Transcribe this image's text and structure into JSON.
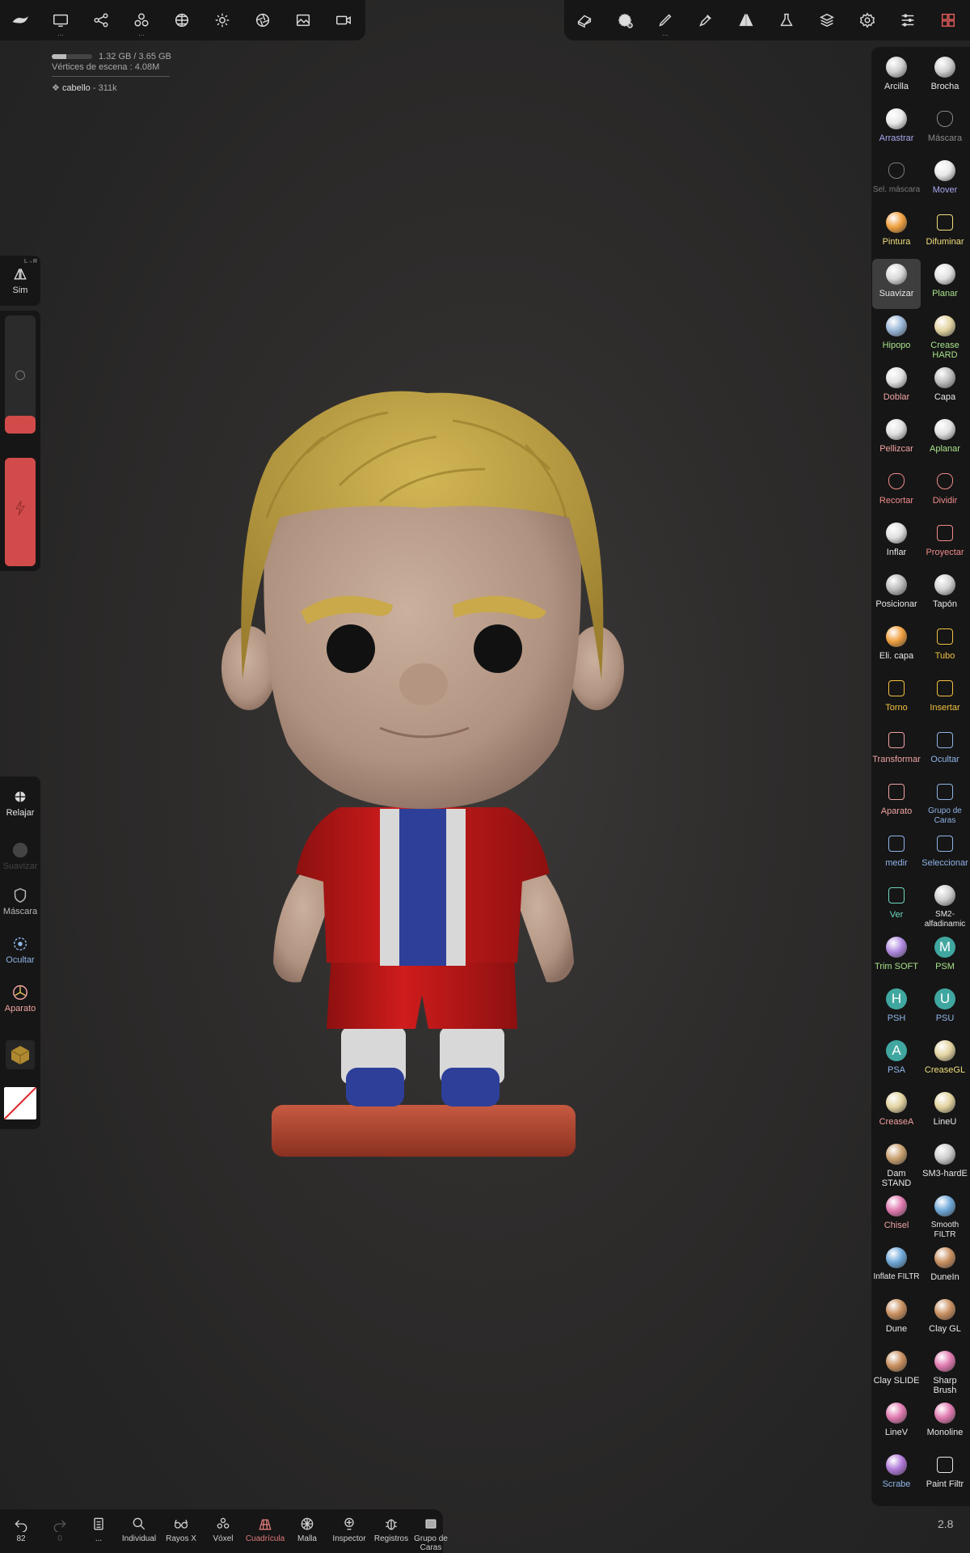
{
  "top_left_toolbar": {
    "items": [
      {
        "icon": "menu-swoosh-icon",
        "dots": ""
      },
      {
        "icon": "monitor-icon",
        "dots": "..."
      },
      {
        "icon": "share-nodes-icon",
        "dots": ""
      },
      {
        "icon": "spheres-icon",
        "dots": "..."
      },
      {
        "icon": "globe-grid-icon",
        "dots": ""
      },
      {
        "icon": "sun-icon",
        "dots": ""
      },
      {
        "icon": "aperture-icon",
        "dots": ""
      },
      {
        "icon": "image-icon",
        "dots": ""
      },
      {
        "icon": "video-camera-icon",
        "dots": ""
      }
    ]
  },
  "top_right_toolbar": {
    "items": [
      {
        "icon": "eraser-cube-icon",
        "dots": ""
      },
      {
        "icon": "stroke-stamp-icon",
        "dots": ""
      },
      {
        "icon": "brush-pen-icon",
        "dots": "..."
      },
      {
        "icon": "dropper-icon",
        "dots": ""
      },
      {
        "icon": "symmetry-icon",
        "dots": ""
      },
      {
        "icon": "flask-icon",
        "dots": ""
      },
      {
        "icon": "layers-icon",
        "dots": ""
      },
      {
        "icon": "settings-gear-icon",
        "dots": ""
      },
      {
        "icon": "sliders-icon",
        "dots": ""
      },
      {
        "icon": "tools-grid-icon",
        "dots": ""
      }
    ]
  },
  "scene_info": {
    "memory": "1.32 GB / 3.65 GB",
    "memory_fraction": 0.36,
    "vertices": "Vértices de escena : 4.08M",
    "object": "cabello",
    "object_count": "311k"
  },
  "left_panel": {
    "sim_label": "Sim",
    "sim_badge": "L→R",
    "tools": [
      {
        "label": "Relajar",
        "icon": "relax-icon",
        "color": "#e8e8e8"
      },
      {
        "label": "Suavizar",
        "icon": "smooth-ball-icon",
        "color": "#4a4a4a"
      },
      {
        "label": "Máscara",
        "icon": "mask-shield-icon",
        "color": "#b8b8b8"
      },
      {
        "label": "Ocultar",
        "icon": "hide-icon",
        "color": "#8fb4e8"
      },
      {
        "label": "Aparato",
        "icon": "gizmo-icon",
        "color": "#f0a3a3"
      }
    ]
  },
  "right_panel": {
    "brushes": [
      {
        "label": "Arcilla",
        "color": "#e8e8e8",
        "ic": "ball",
        "bg": "#cfcfcf"
      },
      {
        "label": "Brocha",
        "color": "#e8e8e8",
        "ic": "ball",
        "bg": "#cfcfcf"
      },
      {
        "label": "Arrastrar",
        "color": "#a9a8f0",
        "ic": "ball",
        "bg": "#e8e8e8"
      },
      {
        "label": "Máscara",
        "color": "#8a8a8a",
        "ic": "shield",
        "bg": "transparent"
      },
      {
        "label": "Sel. máscara",
        "color": "#7a7a7a",
        "ic": "shield",
        "bg": "transparent"
      },
      {
        "label": "Mover",
        "color": "#a9a8f0",
        "ic": "ball",
        "bg": "#e8e8e8"
      },
      {
        "label": "Pintura",
        "color": "#f2de7e",
        "ic": "ball",
        "bg": "#f0a040"
      },
      {
        "label": "Difuminar",
        "color": "#f2de7e",
        "ic": "smudge",
        "bg": "transparent"
      },
      {
        "label": "Suavizar",
        "color": "#e8e8e8",
        "ic": "ball",
        "bg": "#d9d9d9",
        "selected": true
      },
      {
        "label": "Planar",
        "color": "#a7e28a",
        "ic": "ball",
        "bg": "#e0e0e0"
      },
      {
        "label": "Hipopo",
        "color": "#a7e28a",
        "ic": "ball",
        "bg": "#9ab7d8"
      },
      {
        "label": "Crease HARD",
        "color": "#a7e28a",
        "ic": "ball",
        "bg": "#e2d3a0"
      },
      {
        "label": "Doblar",
        "color": "#f0a3a3",
        "ic": "ball",
        "bg": "#e0e0e0"
      },
      {
        "label": "Capa",
        "color": "#e8e8e8",
        "ic": "ball",
        "bg": "#bdbdbd"
      },
      {
        "label": "Pellizcar",
        "color": "#f0a3a3",
        "ic": "ball",
        "bg": "#e0e0e0"
      },
      {
        "label": "Aplanar",
        "color": "#a7e28a",
        "ic": "ball",
        "bg": "#e0e0e0"
      },
      {
        "label": "Recortar",
        "color": "#f08a8a",
        "ic": "trim",
        "bg": "transparent"
      },
      {
        "label": "Dividir",
        "color": "#f08a8a",
        "ic": "split",
        "bg": "transparent"
      },
      {
        "label": "Inflar",
        "color": "#e8e8e8",
        "ic": "ball",
        "bg": "#e0e0e0"
      },
      {
        "label": "Proyectar",
        "color": "#f08a8a",
        "ic": "project",
        "bg": "transparent"
      },
      {
        "label": "Posicionar",
        "color": "#e8e8e8",
        "ic": "ball",
        "bg": "#bbbbbb"
      },
      {
        "label": "Tapón",
        "color": "#e8e8e8",
        "ic": "ball",
        "bg": "#d0d0d0"
      },
      {
        "label": "Eli. capa",
        "color": "#e8e8e8",
        "ic": "ball",
        "bg": "#f0a040"
      },
      {
        "label": "Tubo",
        "color": "#f2c040",
        "ic": "tube",
        "bg": "transparent"
      },
      {
        "label": "Torno",
        "color": "#f2c040",
        "ic": "lathe",
        "bg": "transparent"
      },
      {
        "label": "Insertar",
        "color": "#f2c040",
        "ic": "insert",
        "bg": "transparent"
      },
      {
        "label": "Transformar",
        "color": "#f0a3a3",
        "ic": "transform",
        "bg": "transparent"
      },
      {
        "label": "Ocultar",
        "color": "#8fb4e8",
        "ic": "hide",
        "bg": "transparent"
      },
      {
        "label": "Aparato",
        "color": "#f0a3a3",
        "ic": "gizmo",
        "bg": "transparent"
      },
      {
        "label": "Grupo de Caras",
        "color": "#8fb4e8",
        "ic": "facegroup",
        "bg": "transparent"
      },
      {
        "label": "medir",
        "color": "#8fb4e8",
        "ic": "measure",
        "bg": "transparent"
      },
      {
        "label": "Seleccionar",
        "color": "#8fb4e8",
        "ic": "select",
        "bg": "transparent"
      },
      {
        "label": "Ver",
        "color": "#6fd6c0",
        "ic": "camera",
        "bg": "transparent"
      },
      {
        "label": "SM2-alfadinamic",
        "color": "#e8e8e8",
        "ic": "ball",
        "bg": "#cccccc"
      },
      {
        "label": "Trim SOFT",
        "color": "#a7e28a",
        "ic": "ball",
        "bg": "#b08ae0"
      },
      {
        "label": "PSM",
        "color": "#a7e28a",
        "ic": "letter",
        "bg": "#3fa7a0",
        "letter": "M"
      },
      {
        "label": "PSH",
        "color": "#8fb4e8",
        "ic": "letter",
        "bg": "#3fa7a0",
        "letter": "H"
      },
      {
        "label": "PSU",
        "color": "#8fb4e8",
        "ic": "letter",
        "bg": "#3fa7a0",
        "letter": "U"
      },
      {
        "label": "PSA",
        "color": "#8fb4e8",
        "ic": "letter",
        "bg": "#3fa7a0",
        "letter": "A"
      },
      {
        "label": "CreaseGL",
        "color": "#f2de7e",
        "ic": "ball",
        "bg": "#e2d3a0"
      },
      {
        "label": "CreaseA",
        "color": "#f2a0a0",
        "ic": "ball",
        "bg": "#e2d3a0"
      },
      {
        "label": "LineU",
        "color": "#e8e8e8",
        "ic": "ball",
        "bg": "#e2d3a0"
      },
      {
        "label": "Dam STAND",
        "color": "#e8e8e8",
        "ic": "ball",
        "bg": "#c9a070"
      },
      {
        "label": "SM3-hardE",
        "color": "#e8e8e8",
        "ic": "ball",
        "bg": "#cccccc"
      },
      {
        "label": "Chisel",
        "color": "#f0a3a3",
        "ic": "ball",
        "bg": "#e07ab0"
      },
      {
        "label": "Smooth FILTR",
        "color": "#e8e8e8",
        "ic": "ball",
        "bg": "#6fa8d8"
      },
      {
        "label": "Inflate FILTR",
        "color": "#e8e8e8",
        "ic": "ball",
        "bg": "#6fa8d8"
      },
      {
        "label": "DuneIn",
        "color": "#e8e8e8",
        "ic": "ball",
        "bg": "#c99060"
      },
      {
        "label": "Dune",
        "color": "#e8e8e8",
        "ic": "ball",
        "bg": "#c99060"
      },
      {
        "label": "Clay GL",
        "color": "#e8e8e8",
        "ic": "ball",
        "bg": "#c99060"
      },
      {
        "label": "Clay SLIDE",
        "color": "#e8e8e8",
        "ic": "ball",
        "bg": "#c99060"
      },
      {
        "label": "Sharp Brush",
        "color": "#e8e8e8",
        "ic": "ball",
        "bg": "#e07ab0"
      },
      {
        "label": "LineV",
        "color": "#e8e8e8",
        "ic": "ball",
        "bg": "#e07ab0"
      },
      {
        "label": "Monoline",
        "color": "#e8e8e8",
        "ic": "ball",
        "bg": "#e07ab0"
      },
      {
        "label": "Scrabe",
        "color": "#8fb4e8",
        "ic": "ball",
        "bg": "#b07ad8"
      },
      {
        "label": "Paint Filtr",
        "color": "#e8e8e8",
        "ic": "paintfiltr",
        "bg": "transparent"
      }
    ]
  },
  "bottom_bar": {
    "items": [
      {
        "label": "82",
        "icon": "undo-icon",
        "color": "#d0d0d0"
      },
      {
        "label": "0",
        "icon": "redo-icon",
        "color": "#555"
      },
      {
        "label": "...",
        "icon": "files-icon",
        "color": "#d0d0d0"
      },
      {
        "label": "Individual",
        "icon": "search-icon",
        "color": "#d0d0d0"
      },
      {
        "label": "Rayos X",
        "icon": "xray-glasses-icon",
        "color": "#d0d0d0"
      },
      {
        "label": "Vóxel",
        "icon": "voxel-icon",
        "color": "#d0d0d0"
      },
      {
        "label": "Cuadrícula",
        "icon": "grid-icon",
        "color": "#e07a7a"
      },
      {
        "label": "Malla",
        "icon": "mesh-icon",
        "color": "#d0d0d0"
      },
      {
        "label": "Inspector",
        "icon": "inspector-icon",
        "color": "#d0d0d0"
      },
      {
        "label": "Registros",
        "icon": "bug-icon",
        "color": "#d0d0d0"
      },
      {
        "label": "Grupo de Caras",
        "icon": "facegroup-icon",
        "color": "#d0d0d0"
      }
    ]
  },
  "zoom_value": "2.8",
  "colors": {
    "panel": "#161616",
    "skin": "#b89a86",
    "hair": "#c3a44a",
    "shirt": "#c41a1a",
    "stripe": "#2b3c9a",
    "base": "#a8432d"
  }
}
